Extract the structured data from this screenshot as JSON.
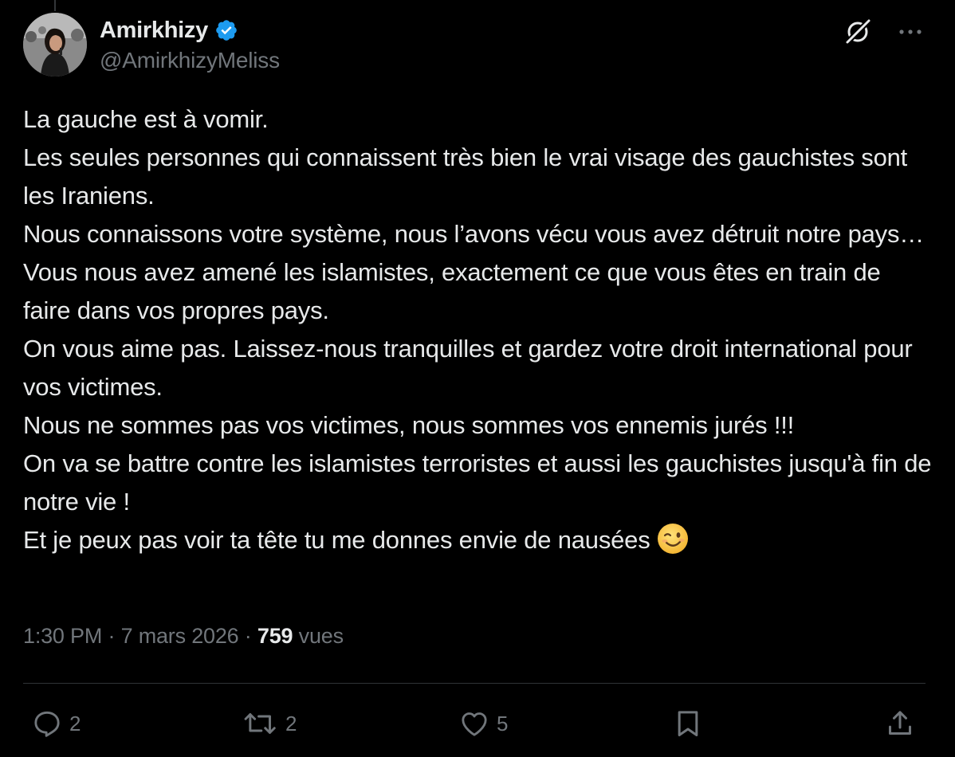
{
  "author": {
    "display_name": "Amirkhizy",
    "handle": "@AmirkhizyMeliss",
    "verified": true
  },
  "tweet": {
    "lines": [
      "La gauche est à vomir.",
      "Les seules personnes qui connaissent très bien le vrai visage des gauchistes sont les Iraniens.",
      "Nous connaissons votre système, nous l’avons vécu vous avez détruit notre pays…",
      "Vous nous avez amené les islamistes, exactement ce que vous êtes en train de faire dans vos propres pays.",
      "On vous aime pas. Laissez-nous tranquilles et gardez votre droit international pour vos victimes.",
      "Nous ne sommes pas vos victimes, nous sommes vos ennemis jurés !!!",
      "On va se battre contre les islamistes terroristes et aussi les gauchistes jusqu'à fin de notre vie !",
      "Et je peux pas voir ta tête tu me donnes envie de nausées"
    ],
    "emoji": "winking-face"
  },
  "meta": {
    "time": "1:30 PM",
    "separator": "·",
    "date": "7 mars 2026",
    "views_count": "759",
    "views_label": "vues"
  },
  "actions": {
    "replies": "2",
    "reposts": "2",
    "likes": "5"
  },
  "icons": {
    "top": [
      "grok-icon",
      "more-icon"
    ],
    "bar": [
      "reply-icon",
      "repost-icon",
      "like-icon",
      "bookmark-icon",
      "share-icon"
    ]
  },
  "colors": {
    "background": "#000000",
    "text_primary": "#e7e9ea",
    "text_secondary": "#71767b",
    "verified": "#1d9bf0",
    "divider": "#2f3336"
  }
}
